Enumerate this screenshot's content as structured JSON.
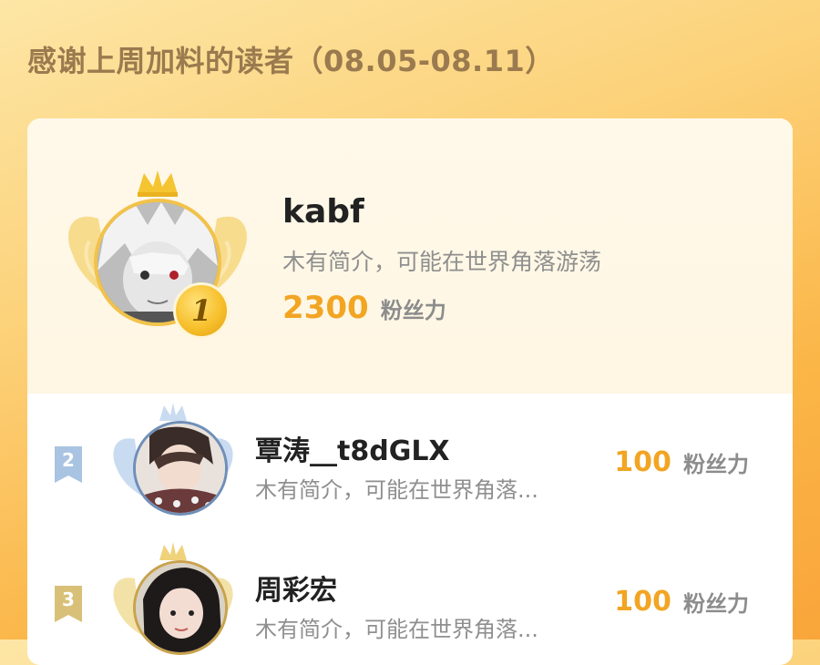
{
  "header": {
    "title": "感谢上周加料的读者（08.05-08.11）"
  },
  "ranking": {
    "top": {
      "rank": "1",
      "name": "kabf",
      "bio": "木有简介，可能在世界角落游荡",
      "fans_value": "2300",
      "fans_label": "粉丝力"
    },
    "list": [
      {
        "rank": "2",
        "name": "覃涛__t8dGLX",
        "bio": "木有简介，可能在世界角落...",
        "fans_value": "100",
        "fans_label": "粉丝力"
      },
      {
        "rank": "3",
        "name": "周彩宏",
        "bio": "木有简介，可能在世界角落...",
        "fans_value": "100",
        "fans_label": "粉丝力"
      }
    ]
  },
  "colors": {
    "gold": "#f2c24a",
    "silver": "#9fbbdc",
    "bronze": "#d8c078",
    "fans_value": "#f2a523"
  }
}
